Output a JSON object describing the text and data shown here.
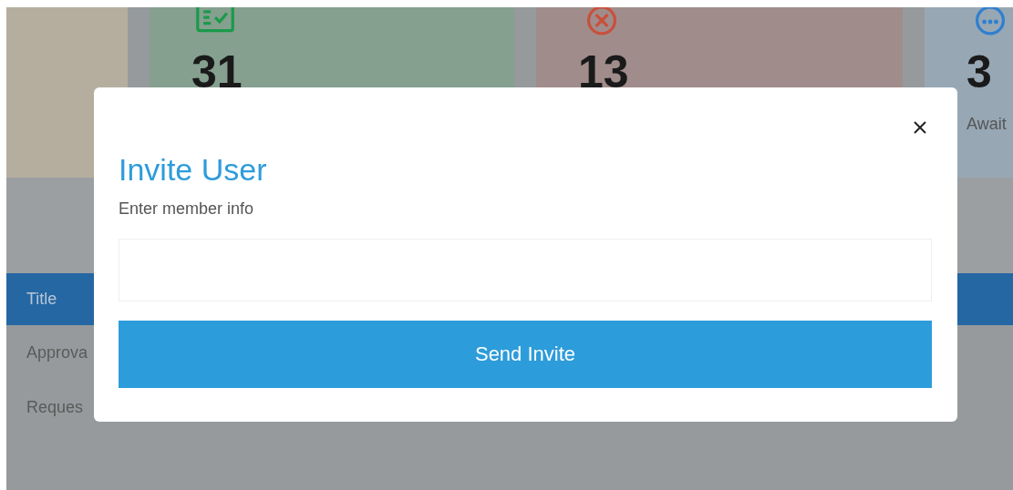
{
  "cards": [
    {
      "kind": "plain"
    },
    {
      "kind": "approved",
      "value": "31"
    },
    {
      "kind": "rejected",
      "value": "13"
    },
    {
      "kind": "awaiting",
      "value": "3",
      "label": "Await"
    }
  ],
  "table": {
    "header": "Title",
    "rows": [
      "Approva",
      "Reques"
    ]
  },
  "modal": {
    "title": "Invite User",
    "subtitle": "Enter member info",
    "button": "Send Invite"
  }
}
